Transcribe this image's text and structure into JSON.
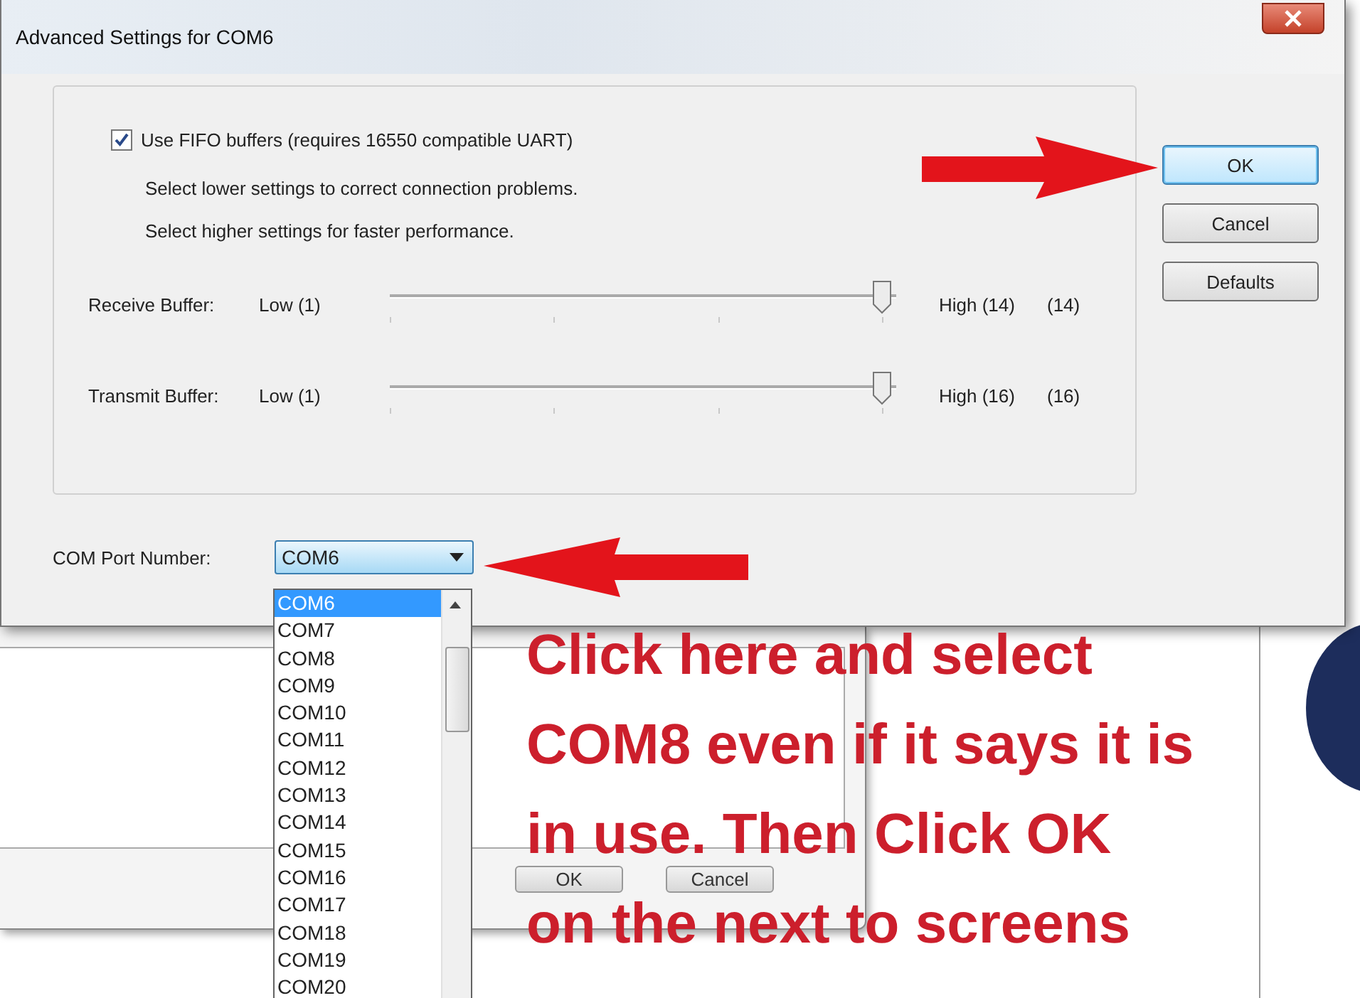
{
  "dialog": {
    "title": "Advanced Settings for COM6",
    "fifo": {
      "label": "Use FIFO buffers (requires 16550 compatible UART)",
      "checked": true
    },
    "hints": [
      "Select lower settings to correct connection problems.",
      "Select higher settings for faster performance."
    ],
    "sliders": [
      {
        "label": "Receive Buffer:",
        "low": "Low (1)",
        "high": "High (14)",
        "reading": "(14)",
        "level": 1
      },
      {
        "label": "Transmit Buffer:",
        "low": "Low (1)",
        "high": "High (16)",
        "reading": "(16)",
        "level": 1
      }
    ],
    "buttons": [
      {
        "label": "OK",
        "default": true
      },
      {
        "label": "Cancel",
        "default": false
      },
      {
        "label": "Defaults",
        "default": false
      }
    ],
    "port": {
      "label": "COM Port Number:",
      "value": "COM6",
      "options": [
        {
          "label": "COM6",
          "selected": true
        },
        {
          "label": "COM7",
          "selected": false
        },
        {
          "label": "COM8",
          "selected": false
        },
        {
          "label": "COM9",
          "selected": false
        },
        {
          "label": "COM10",
          "selected": false
        },
        {
          "label": "COM11",
          "selected": false
        },
        {
          "label": "COM12",
          "selected": false
        },
        {
          "label": "COM13",
          "selected": false
        },
        {
          "label": "COM14",
          "selected": false
        },
        {
          "label": "COM15",
          "selected": false
        },
        {
          "label": "COM16",
          "selected": false
        },
        {
          "label": "COM17",
          "selected": false
        },
        {
          "label": "COM18",
          "selected": false
        },
        {
          "label": "COM19",
          "selected": false
        },
        {
          "label": "COM20",
          "selected": false
        }
      ]
    }
  },
  "background_window": {
    "buttons": [
      "OK",
      "Cancel"
    ]
  },
  "annotation": {
    "lines": [
      "Click here and select",
      "COM8 even if it says it is",
      "in use. Then Click OK",
      "on the next to screens"
    ]
  }
}
